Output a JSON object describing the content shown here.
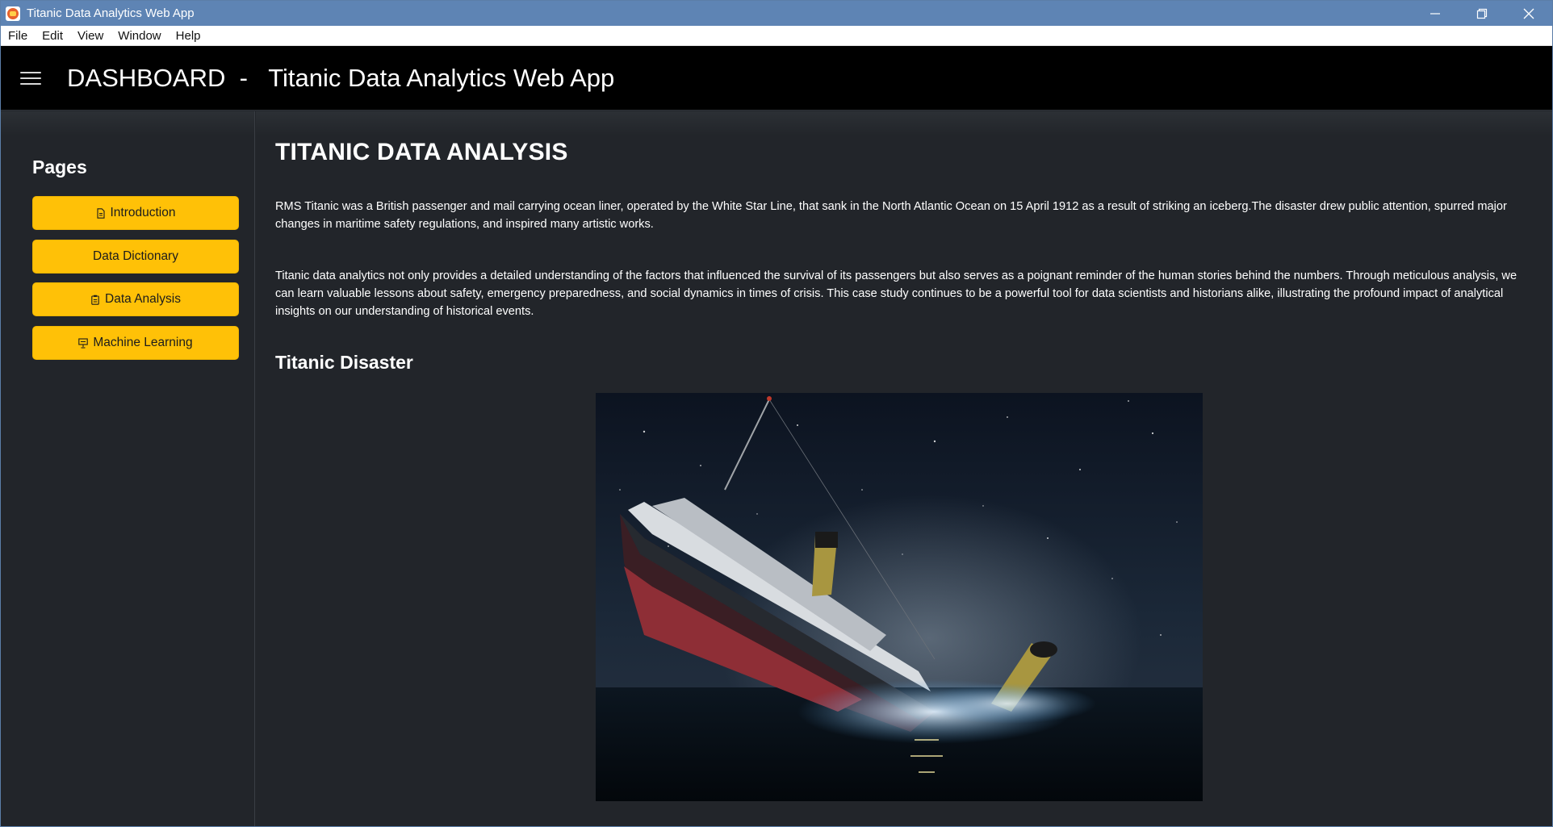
{
  "window": {
    "title": "Titanic Data Analytics Web App"
  },
  "menubar": {
    "items": [
      "File",
      "Edit",
      "View",
      "Window",
      "Help"
    ]
  },
  "header": {
    "title": "DASHBOARD  -   Titanic Data Analytics Web App"
  },
  "sidebar": {
    "title": "Pages",
    "items": [
      {
        "label": "Introduction",
        "icon": "document-icon"
      },
      {
        "label": "Data Dictionary",
        "icon": ""
      },
      {
        "label": "Data Analysis",
        "icon": "clipboard-icon"
      },
      {
        "label": "Machine Learning",
        "icon": "presentation-icon"
      }
    ]
  },
  "main": {
    "title": "TITANIC DATA ANALYSIS",
    "paragraphs": [
      "RMS Titanic was a British passenger and mail carrying ocean liner, operated by the White Star Line, that sank in the North Atlantic Ocean on 15 April 1912 as a result of striking an iceberg.The disaster drew public attention, spurred major changes in maritime safety regulations, and inspired many artistic works.",
      "Titanic data analytics not only provides a detailed understanding of the factors that influenced the survival of its passengers but also serves as a poignant reminder of the human stories behind the numbers. Through meticulous analysis, we can learn valuable lessons about safety, emergency preparedness, and social dynamics in times of crisis. This case study continues to be a powerful tool for data scientists and historians alike, illustrating the profound impact of analytical insights on our understanding of historical events."
    ],
    "section_title": "Titanic Disaster"
  },
  "colors": {
    "accent": "#ffc107",
    "background": "#22252a",
    "header": "#000000",
    "titlebar": "#5e84b4"
  }
}
